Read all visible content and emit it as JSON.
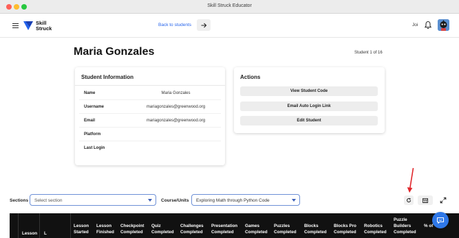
{
  "window": {
    "title": "Skill Struck Educator"
  },
  "header": {
    "brand_line1": "Skill",
    "brand_line2": "Struck",
    "back_label": "Back to students",
    "user_name": "Joi"
  },
  "student": {
    "name": "Maria Gonzales",
    "counter": "Student 1 of 16"
  },
  "info_card": {
    "title": "Student Information",
    "rows": [
      {
        "label": "Name",
        "value": "Maria Gonzales"
      },
      {
        "label": "Username",
        "value": "mariagonzales@greenwood.org"
      },
      {
        "label": "Email",
        "value": "mariagonzales@greenwood.org"
      },
      {
        "label": "Platform",
        "value": ""
      },
      {
        "label": "Last Login",
        "value": ""
      }
    ]
  },
  "actions_card": {
    "title": "Actions",
    "buttons": [
      "View Student Code",
      "Email Auto Login Link",
      "Edit Student"
    ]
  },
  "filters": {
    "sections_label": "Sections",
    "sections_placeholder": "Select section",
    "course_label": "Course/Units",
    "course_value": "Exploring Math through Python Code"
  },
  "table": {
    "headers": [
      [
        "Lesson",
        "Started"
      ],
      [
        "Lesson",
        "Finished"
      ],
      [
        "Checkpoint",
        "Completed"
      ],
      [
        "Quiz",
        "Completed"
      ],
      [
        "Challenges",
        "Completed"
      ],
      [
        "Presentation",
        "Completed"
      ],
      [
        "Games",
        "Completed"
      ],
      [
        "Puzzles",
        "Completed"
      ],
      [
        "Blocks",
        "Completed"
      ],
      [
        "Blocks Pro",
        "Completed"
      ],
      [
        "Robotics",
        "Completed"
      ],
      [
        "Puzzle",
        "Builders",
        "Completed"
      ],
      [
        "% of",
        ""
      ]
    ],
    "first_cols": [
      "Lesson",
      "L"
    ]
  },
  "colors": {
    "accent": "#2563eb",
    "select_border": "#6c8fd6",
    "table_header_bg": "#111111",
    "annotation_arrow": "#e0262b",
    "chat_fab": "#2f78e8"
  },
  "icons": {
    "menu": "hamburger-icon",
    "back": "arrow-right-icon",
    "notifications": "bell-icon",
    "refresh": "refresh-icon",
    "columns": "table-icon",
    "expand": "expand-icon",
    "chat": "chat-icon"
  }
}
